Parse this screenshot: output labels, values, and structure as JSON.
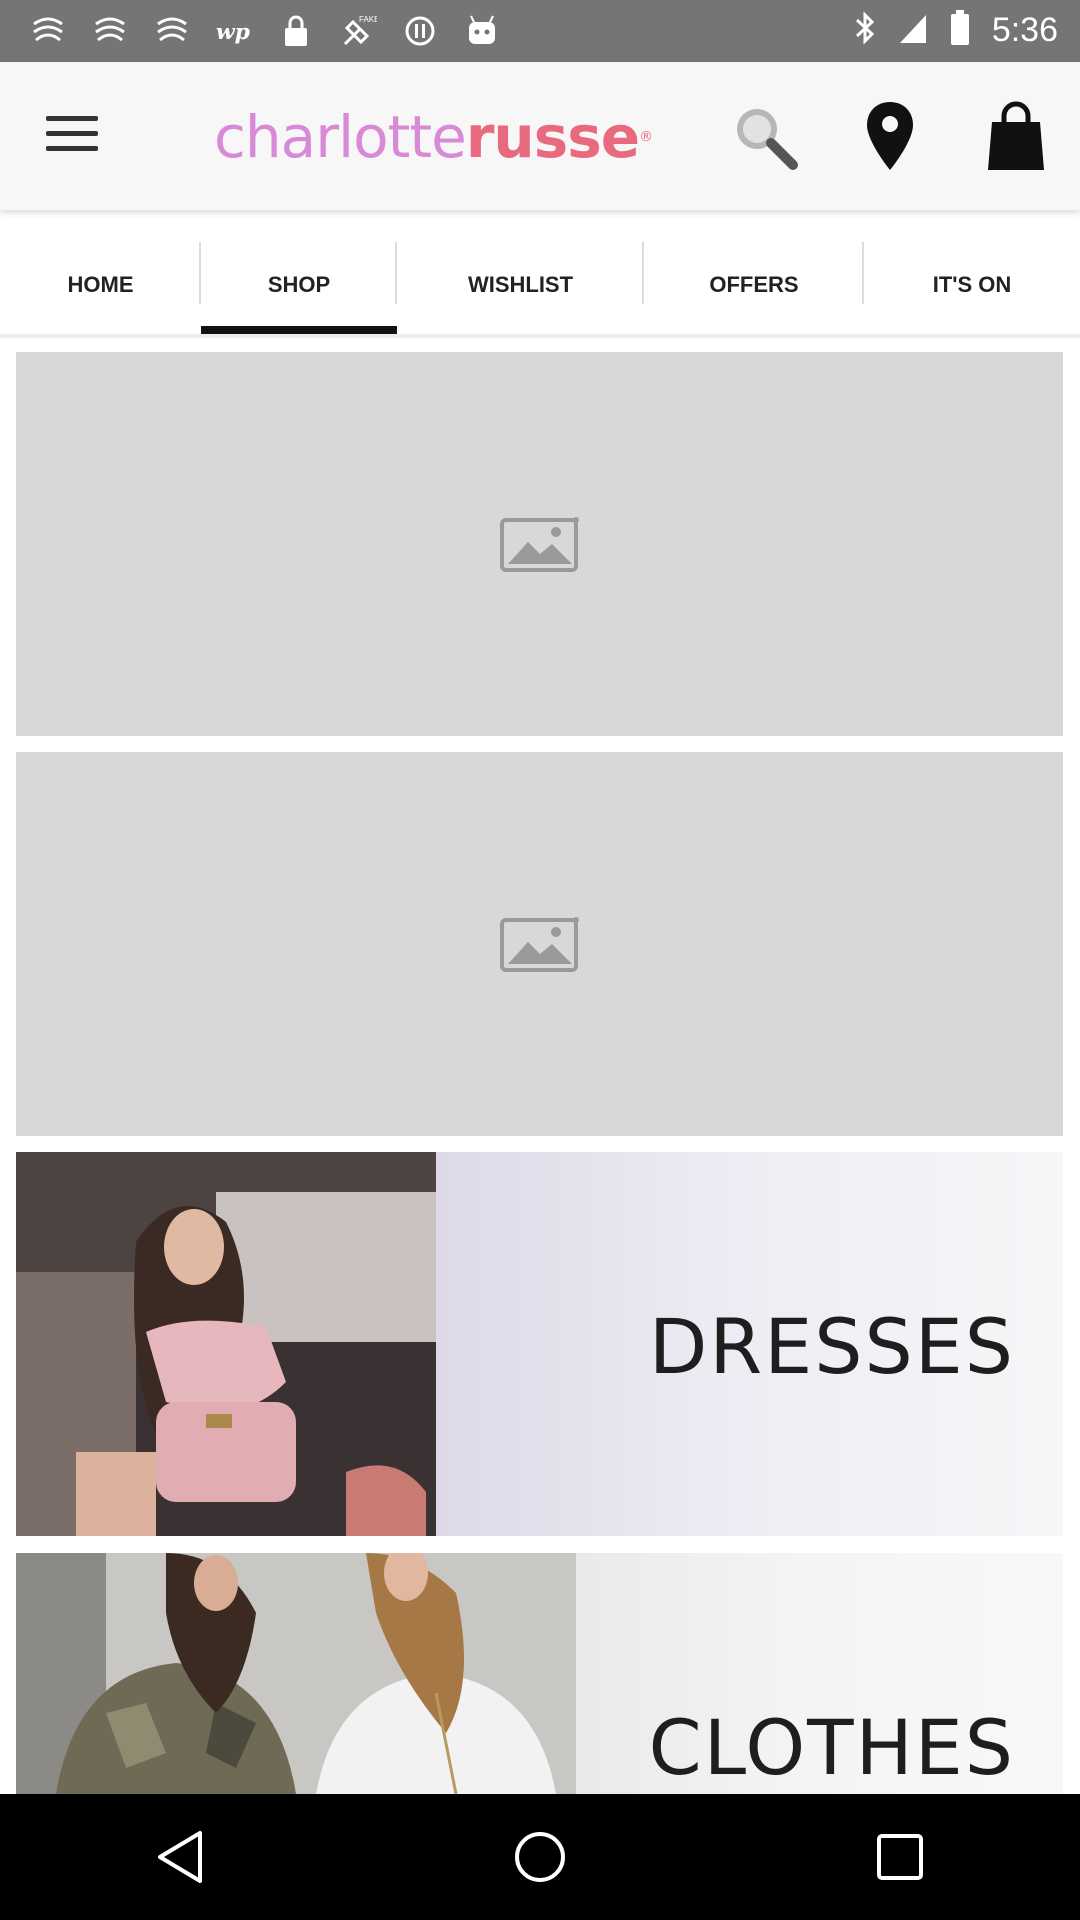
{
  "status_bar": {
    "time": "5:36",
    "left_icons": [
      "notification-icon",
      "notification-icon",
      "notification-icon",
      "wp-icon",
      "lock-icon",
      "fake-gps-icon",
      "info-icon",
      "android-icon"
    ],
    "right_icons": [
      "bluetooth-icon",
      "signal-icon",
      "battery-icon"
    ]
  },
  "app_bar": {
    "logo_part1": "charlotte",
    "logo_part2": "russe",
    "logo_mark": "®",
    "icons": [
      "menu-icon",
      "search-icon",
      "location-pin-icon",
      "shopping-bag-icon"
    ]
  },
  "tabs": [
    {
      "label": "HOME"
    },
    {
      "label": "SHOP"
    },
    {
      "label": "WISHLIST"
    },
    {
      "label": "OFFERS"
    },
    {
      "label": "IT'S ON"
    }
  ],
  "active_tab": "SHOP",
  "content": {
    "banners": [
      {
        "label": "DRESSES"
      },
      {
        "label": "CLOTHES"
      }
    ]
  },
  "nav_bar": [
    "back-icon",
    "home-icon",
    "recents-icon"
  ],
  "colors": {
    "status_bar": "#757575",
    "app_bar": "#f7f7f7",
    "logo_pink": "#d88ad6",
    "logo_red": "#e86a7e",
    "placeholder": "#d8d8d8"
  }
}
